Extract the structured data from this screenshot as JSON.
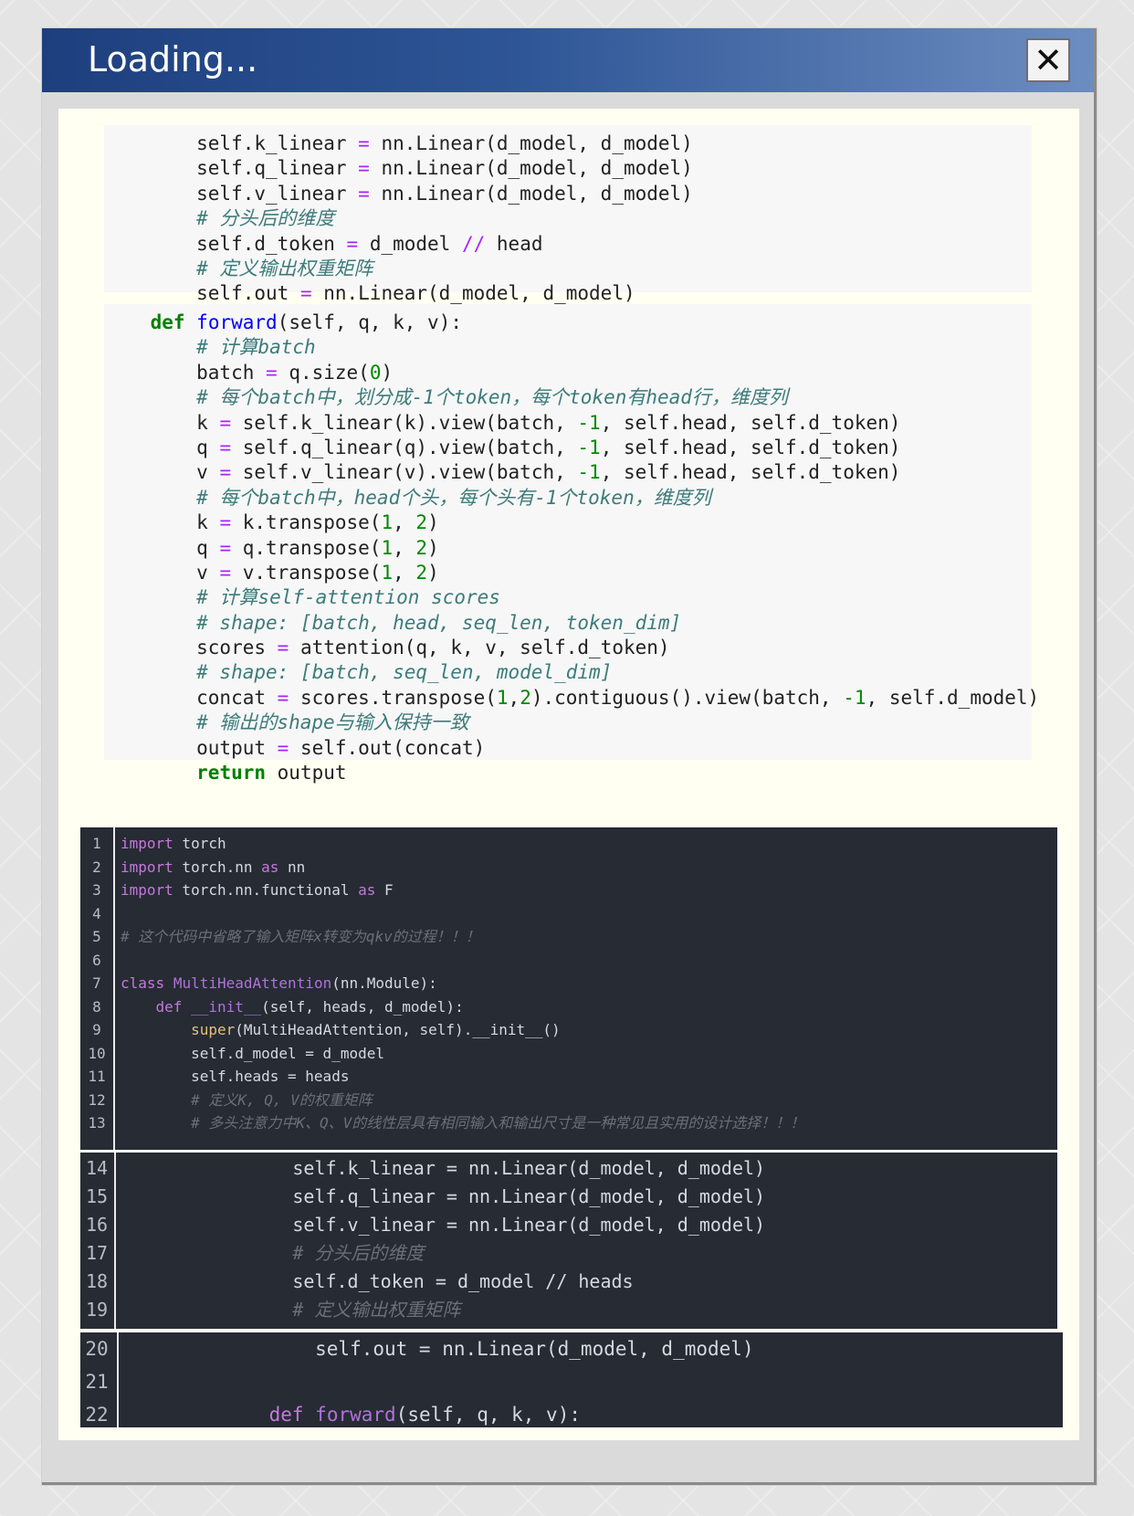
{
  "window": {
    "title": "Loading...",
    "close_symbol": "✕"
  },
  "notebook_cell_1": {
    "lines": [
      [
        [
          "        self.k_linear ",
          ""
        ],
        [
          "=",
          "op"
        ],
        [
          " nn.Linear(d_model, d_model)",
          ""
        ]
      ],
      [
        [
          "        self.q_linear ",
          ""
        ],
        [
          "=",
          "op"
        ],
        [
          " nn.Linear(d_model, d_model)",
          ""
        ]
      ],
      [
        [
          "        self.v_linear ",
          ""
        ],
        [
          "=",
          "op"
        ],
        [
          " nn.Linear(d_model, d_model)",
          ""
        ]
      ],
      [
        [
          "        # 分头后的维度",
          "cmt"
        ]
      ],
      [
        [
          "        self.d_token ",
          ""
        ],
        [
          "=",
          "op"
        ],
        [
          " d_model ",
          ""
        ],
        [
          "//",
          "op"
        ],
        [
          " head",
          ""
        ]
      ],
      [
        [
          "        # 定义输出权重矩阵",
          "cmt"
        ]
      ],
      [
        [
          "        self.out ",
          ""
        ],
        [
          "=",
          "op"
        ],
        [
          " nn.Linear(d_model, d_model)",
          ""
        ]
      ]
    ]
  },
  "notebook_cell_2": {
    "lines": [
      [
        [
          "    ",
          ""
        ],
        [
          "def",
          "k"
        ],
        [
          " ",
          ""
        ],
        [
          "forward",
          "fn"
        ],
        [
          "(self, q, k, v):",
          ""
        ]
      ],
      [
        [
          "        # 计算batch",
          "cmt"
        ]
      ],
      [
        [
          "        batch ",
          ""
        ],
        [
          "=",
          "op"
        ],
        [
          " q.size(",
          ""
        ],
        [
          "0",
          "num"
        ],
        [
          ")",
          ""
        ]
      ],
      [
        [
          "        # 每个batch中，划分成-1个token，每个token有head行，维度列",
          "cmt"
        ]
      ],
      [
        [
          "        k ",
          ""
        ],
        [
          "=",
          "op"
        ],
        [
          " self.k_linear(k).view(batch, ",
          ""
        ],
        [
          "-1",
          "num"
        ],
        [
          ", self.head, self.d_token)",
          ""
        ]
      ],
      [
        [
          "        q ",
          ""
        ],
        [
          "=",
          "op"
        ],
        [
          " self.q_linear(q).view(batch, ",
          ""
        ],
        [
          "-1",
          "num"
        ],
        [
          ", self.head, self.d_token)",
          ""
        ]
      ],
      [
        [
          "        v ",
          ""
        ],
        [
          "=",
          "op"
        ],
        [
          " self.v_linear(v).view(batch, ",
          ""
        ],
        [
          "-1",
          "num"
        ],
        [
          ", self.head, self.d_token)",
          ""
        ]
      ],
      [
        [
          "        # 每个batch中，head个头，每个头有-1个token，维度列",
          "cmt"
        ]
      ],
      [
        [
          "        k ",
          ""
        ],
        [
          "=",
          "op"
        ],
        [
          " k.transpose(",
          ""
        ],
        [
          "1",
          "num"
        ],
        [
          ", ",
          ""
        ],
        [
          "2",
          "num"
        ],
        [
          ")",
          ""
        ]
      ],
      [
        [
          "        q ",
          ""
        ],
        [
          "=",
          "op"
        ],
        [
          " q.transpose(",
          ""
        ],
        [
          "1",
          "num"
        ],
        [
          ", ",
          ""
        ],
        [
          "2",
          "num"
        ],
        [
          ")",
          ""
        ]
      ],
      [
        [
          "        v ",
          ""
        ],
        [
          "=",
          "op"
        ],
        [
          " v.transpose(",
          ""
        ],
        [
          "1",
          "num"
        ],
        [
          ", ",
          ""
        ],
        [
          "2",
          "num"
        ],
        [
          ")",
          ""
        ]
      ],
      [
        [
          "        # 计算self-attention scores",
          "cmt"
        ]
      ],
      [
        [
          "        # shape: [batch, head, seq_len, token_dim]",
          "cmt"
        ]
      ],
      [
        [
          "        scores ",
          ""
        ],
        [
          "=",
          "op"
        ],
        [
          " attention(q, k, v, self.d_token)",
          ""
        ]
      ],
      [
        [
          "        # shape: [batch, seq_len, model_dim]",
          "cmt"
        ]
      ],
      [
        [
          "        concat ",
          ""
        ],
        [
          "=",
          "op"
        ],
        [
          " scores.transpose(",
          ""
        ],
        [
          "1",
          "num"
        ],
        [
          ",",
          ""
        ],
        [
          "2",
          "num"
        ],
        [
          ").contiguous().view(batch, ",
          ""
        ],
        [
          "-1",
          "num"
        ],
        [
          ", self.d_model)",
          ""
        ]
      ],
      [
        [
          "        # 输出的shape与输入保持一致",
          "cmt"
        ]
      ],
      [
        [
          "        output ",
          ""
        ],
        [
          "=",
          "op"
        ],
        [
          " self.out(concat)",
          ""
        ]
      ],
      [
        [
          "        ",
          ""
        ],
        [
          "return",
          "k"
        ],
        [
          " output",
          ""
        ]
      ]
    ]
  },
  "editor_1": {
    "rows": [
      {
        "num": "1",
        "code": [
          [
            "import",
            "ek"
          ],
          [
            " torch",
            ""
          ]
        ]
      },
      {
        "num": "2",
        "code": [
          [
            "import",
            "ek"
          ],
          [
            " torch.nn ",
            ""
          ],
          [
            "as",
            "ek"
          ],
          [
            " nn",
            ""
          ]
        ]
      },
      {
        "num": "3",
        "code": [
          [
            "import",
            "ek"
          ],
          [
            " torch.nn.functional ",
            ""
          ],
          [
            "as",
            "ek"
          ],
          [
            " F",
            ""
          ]
        ]
      },
      {
        "num": "4",
        "code": []
      },
      {
        "num": "5",
        "code": [
          [
            "# 这个代码中省略了输入矩阵x转变为qkv的过程！！！",
            "ecm"
          ]
        ]
      },
      {
        "num": "6",
        "code": []
      },
      {
        "num": "7",
        "code": [
          [
            "class",
            "ek"
          ],
          [
            " ",
            ""
          ],
          [
            "MultiHeadAttention",
            "ecls"
          ],
          [
            "(nn.Module):",
            ""
          ]
        ]
      },
      {
        "num": "8",
        "code": [
          [
            "    ",
            ""
          ],
          [
            "def",
            "ek"
          ],
          [
            " ",
            ""
          ],
          [
            "__init__",
            "ecls"
          ],
          [
            "(self, heads, d_model):",
            ""
          ]
        ]
      },
      {
        "num": "9",
        "code": [
          [
            "        ",
            ""
          ],
          [
            "super",
            "esup"
          ],
          [
            "(MultiHeadAttention, self).__init__()",
            ""
          ]
        ]
      },
      {
        "num": "10",
        "code": [
          [
            "        self.d_model = d_model",
            ""
          ]
        ]
      },
      {
        "num": "11",
        "code": [
          [
            "        self.heads = heads",
            ""
          ]
        ]
      },
      {
        "num": "12",
        "code": [
          [
            "        # 定义K, Q, V的权重矩阵",
            "ecm"
          ]
        ]
      },
      {
        "num": "13",
        "code": [
          [
            "        # 多头注意力中K、Q、V的线性层具有相同输入和输出尺寸是一种常见且实用的设计选择！！！",
            "ecm"
          ]
        ]
      }
    ]
  },
  "editor_2": {
    "rows": [
      {
        "num": "14",
        "code": [
          [
            "        self.k_linear = nn.Linear(d_model, d_model)",
            ""
          ]
        ]
      },
      {
        "num": "15",
        "code": [
          [
            "        self.q_linear = nn.Linear(d_model, d_model)",
            ""
          ]
        ]
      },
      {
        "num": "16",
        "code": [
          [
            "        self.v_linear = nn.Linear(d_model, d_model)",
            ""
          ]
        ]
      },
      {
        "num": "17",
        "code": [
          [
            "        # 分头后的维度",
            "ecm"
          ]
        ]
      },
      {
        "num": "18",
        "code": [
          [
            "        self.d_token = d_model // heads",
            ""
          ]
        ]
      },
      {
        "num": "19",
        "code": [
          [
            "        # 定义输出权重矩阵",
            "ecm"
          ]
        ]
      }
    ]
  },
  "editor_3": {
    "rows": [
      {
        "num": "20",
        "code": [
          [
            "        self.out = nn.Linear(d_model, d_model)",
            ""
          ]
        ]
      },
      {
        "num": "21",
        "code": []
      },
      {
        "num": "22",
        "code": [
          [
            "    ",
            ""
          ],
          [
            "def",
            "ek"
          ],
          [
            " ",
            ""
          ],
          [
            "forward",
            "ecls"
          ],
          [
            "(self, q, k, v):",
            ""
          ]
        ]
      }
    ]
  }
}
